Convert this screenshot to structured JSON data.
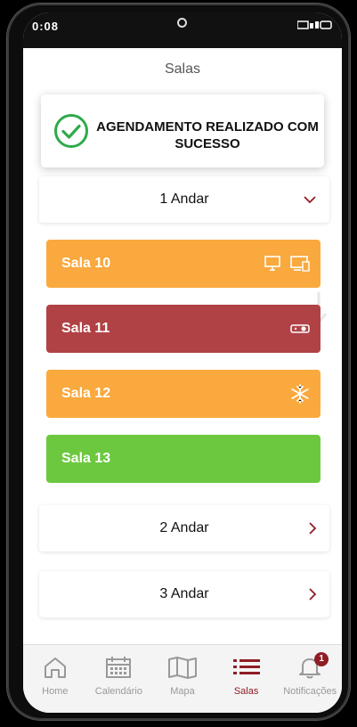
{
  "statusbar": {
    "left_text": "0:08",
    "right_text": ""
  },
  "header": {
    "title": "Salas"
  },
  "toast": {
    "message": "AGENDAMENTO REALIZADO COM SUCESSO",
    "icon": "check-circle-icon",
    "color": "#2eaa4a"
  },
  "floors": [
    {
      "label": "1 Andar",
      "expanded": true
    },
    {
      "label": "2 Andar",
      "expanded": false
    },
    {
      "label": "3 Andar",
      "expanded": false
    }
  ],
  "rooms": [
    {
      "label": "Sala 10",
      "color": "#f9a93e",
      "icons": [
        "computer-icon",
        "monitor-icon"
      ]
    },
    {
      "label": "Sala  11",
      "color": "#b04246",
      "icons": [
        "projector-icon"
      ]
    },
    {
      "label": "Sala  12",
      "color": "#f9a93e",
      "icons": [
        "snowflake-icon"
      ]
    },
    {
      "label": "Sala 13",
      "color": "#6cc93f",
      "icons": []
    }
  ],
  "tabbar": {
    "items": [
      {
        "label": "Home",
        "icon": "home-icon",
        "active": false
      },
      {
        "label": "Calendário",
        "icon": "calendar-icon",
        "active": false
      },
      {
        "label": "Mapa",
        "icon": "map-icon",
        "active": false
      },
      {
        "label": "Salas",
        "icon": "list-icon",
        "active": true
      },
      {
        "label": "Notificações",
        "icon": "bell-icon",
        "active": false,
        "badge": "1"
      }
    ]
  },
  "colors": {
    "accent": "#8e1e24",
    "inactive": "#999999"
  }
}
